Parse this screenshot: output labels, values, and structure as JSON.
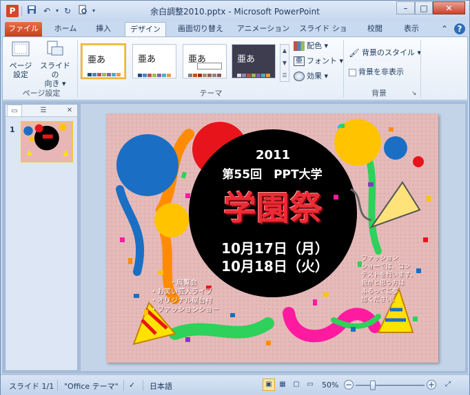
{
  "window": {
    "title": "余白調整2010.pptx - Microsoft PowerPoint",
    "app_icon_letter": "P"
  },
  "ribbon_tabs": [
    "ファイル",
    "ホーム",
    "挿入",
    "デザイン",
    "画面切り替え",
    "アニメーション",
    "スライド ショー",
    "校閲",
    "表示"
  ],
  "active_tab": "デザイン",
  "ribbon": {
    "page_setup_group": {
      "label": "ページ設定",
      "page_setup_line1": "ページ",
      "page_setup_line2": "設定",
      "orientation_line1": "スライドの",
      "orientation_line2": "向き ▾"
    },
    "themes_group": {
      "label": "テーマ",
      "theme_sample_text": "亜あ",
      "colors": "配色 ▾",
      "fonts": "フォント ▾",
      "effects": "効果 ▾"
    },
    "background_group": {
      "label": "背景",
      "styles": "背景のスタイル ▾",
      "hide_graphics": "背景を非表示"
    }
  },
  "slides_pane": {
    "slide_number": "1"
  },
  "slide": {
    "year": "2011",
    "subtitle": "第55回　PPT大学",
    "main_title": "学園祭",
    "date1": "10月17日（月）",
    "date2": "10月18日（火）",
    "events_title": "・展覧会",
    "events": [
      "・お笑い芸人ライブ",
      "・オリジナル屋台村",
      "・ファッションショー"
    ],
    "note": [
      "ファッション",
      "ショーでは、コン",
      "テストを行います。",
      "我がと思う方は",
      "ふるってご参",
      "加ください。"
    ]
  },
  "status": {
    "slide_info": "スライド 1/1",
    "theme_name": "\"Office テーマ\"",
    "language": "日本語",
    "zoom": "50%"
  }
}
